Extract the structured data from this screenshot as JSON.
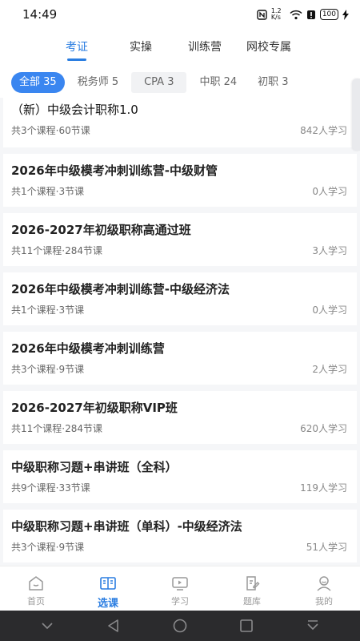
{
  "status": {
    "time": "14:49",
    "net_speed": "1.2 K/s",
    "battery": "100"
  },
  "top_tabs": [
    {
      "label": "考证",
      "active": true
    },
    {
      "label": "实操",
      "active": false
    },
    {
      "label": "训练营",
      "active": false
    },
    {
      "label": "网校专属",
      "active": false
    }
  ],
  "filters": [
    {
      "label": "全部 35",
      "active": true
    },
    {
      "label": "税务师 5",
      "active": false
    },
    {
      "label": "CPA 3",
      "active": false
    },
    {
      "label": "中职 24",
      "active": false
    },
    {
      "label": "初职 3",
      "active": false
    }
  ],
  "courses": [
    {
      "title": "（新）中级会计职称1.0",
      "meta": "共3个课程·60节课",
      "count": "842人学习"
    },
    {
      "title": "2026年中级模考冲刺训练营-中级财管",
      "meta": "共1个课程·3节课",
      "count": "0人学习"
    },
    {
      "title": "2026-2027年初级职称高通过班",
      "meta": "共11个课程·284节课",
      "count": "3人学习"
    },
    {
      "title": "2026年中级模考冲刺训练营-中级经济法",
      "meta": "共1个课程·3节课",
      "count": "0人学习"
    },
    {
      "title": "2026年中级模考冲刺训练营",
      "meta": "共3个课程·9节课",
      "count": "2人学习"
    },
    {
      "title": "2026-2027年初级职称VIP班",
      "meta": "共11个课程·284节课",
      "count": "620人学习"
    },
    {
      "title": "中级职称习题+串讲班（全科）",
      "meta": "共9个课程·33节课",
      "count": "119人学习"
    },
    {
      "title": "中级职称习题+串讲班（单科）-中级经济法",
      "meta": "共3个课程·9节课",
      "count": "51人学习"
    }
  ],
  "bottom_nav": [
    {
      "label": "首页",
      "icon": "home-icon"
    },
    {
      "label": "选课",
      "icon": "book-icon",
      "active": true
    },
    {
      "label": "学习",
      "icon": "video-icon"
    },
    {
      "label": "题库",
      "icon": "edit-icon"
    },
    {
      "label": "我的",
      "icon": "user-icon"
    }
  ],
  "colors": {
    "accent": "#2a7de1",
    "chip_active": "#3a86f0"
  }
}
